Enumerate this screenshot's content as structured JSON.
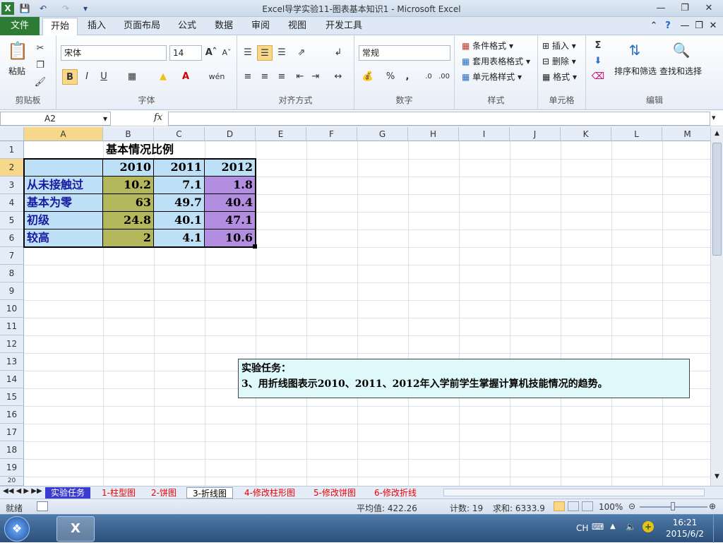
{
  "window": {
    "title": "Excel导学实验11-图表基本知识1 - Microsoft Excel"
  },
  "tabs": {
    "file": "文件",
    "items": [
      "开始",
      "插入",
      "页面布局",
      "公式",
      "数据",
      "审阅",
      "视图",
      "开发工具"
    ]
  },
  "ribbon": {
    "clipboard": {
      "paste": "粘贴",
      "label": "剪贴板"
    },
    "font": {
      "name": "宋体",
      "size": "14",
      "label": "字体",
      "bold": "B",
      "italic": "I",
      "underline": "U",
      "wen": "wén"
    },
    "align": {
      "label": "对齐方式"
    },
    "number": {
      "format": "常规",
      "label": "数字",
      "pct": "%",
      "comma": ","
    },
    "styles": {
      "cond": "条件格式",
      "table": "套用表格格式",
      "cell": "单元格样式",
      "label": "样式"
    },
    "cells": {
      "insert": "插入",
      "delete": "删除",
      "format": "格式",
      "label": "单元格"
    },
    "edit": {
      "sort": "排序和筛选",
      "find": "查找和选择",
      "label": "编辑"
    }
  },
  "formula_bar": {
    "name_box": "A2",
    "fx": "fx",
    "formula": ""
  },
  "columns": [
    "A",
    "B",
    "C",
    "D",
    "E",
    "F",
    "G",
    "H",
    "I",
    "J",
    "K",
    "L",
    "M"
  ],
  "rows": [
    "1",
    "2",
    "3",
    "4",
    "5",
    "6",
    "7",
    "8",
    "9",
    "10",
    "11",
    "12",
    "13",
    "14",
    "15",
    "16",
    "17",
    "18",
    "19",
    "20"
  ],
  "sheet": {
    "title": "基本情况比例",
    "years": [
      "2010",
      "2011",
      "2012"
    ],
    "row_labels": [
      "从未接触过",
      "基本为零",
      "初级",
      "较高"
    ],
    "values": [
      [
        "10.2",
        "7.1",
        "1.8"
      ],
      [
        "63",
        "49.7",
        "40.4"
      ],
      [
        "24.8",
        "40.1",
        "47.1"
      ],
      [
        "2",
        "4.1",
        "10.6"
      ]
    ]
  },
  "textbox": {
    "line1": "实验任务：",
    "line2": "3、用折线图表示2010、2011、2012年入学前学生掌握计算机技能情况的趋势。"
  },
  "sheet_tabs": [
    "实验任务",
    "1-柱型图",
    "2-饼图",
    "3-折线图",
    "4-修改柱形图",
    "5-修改饼图",
    "6-修改折线"
  ],
  "status": {
    "ready": "就绪",
    "avg": "平均值: 422.26",
    "count": "计数: 19",
    "sum": "求和: 6333.9",
    "zoom": "100%"
  },
  "taskbar": {
    "lang": "CH",
    "time": "16:21",
    "date": "2015/6/2"
  },
  "colors": {
    "col_b": "#b5b75c",
    "col_c": "#bde0f6",
    "col_d": "#b38ee0",
    "header_fill": "#bde0f6",
    "textbox": "#dff8fa",
    "file_tab": "#2d7b34"
  }
}
